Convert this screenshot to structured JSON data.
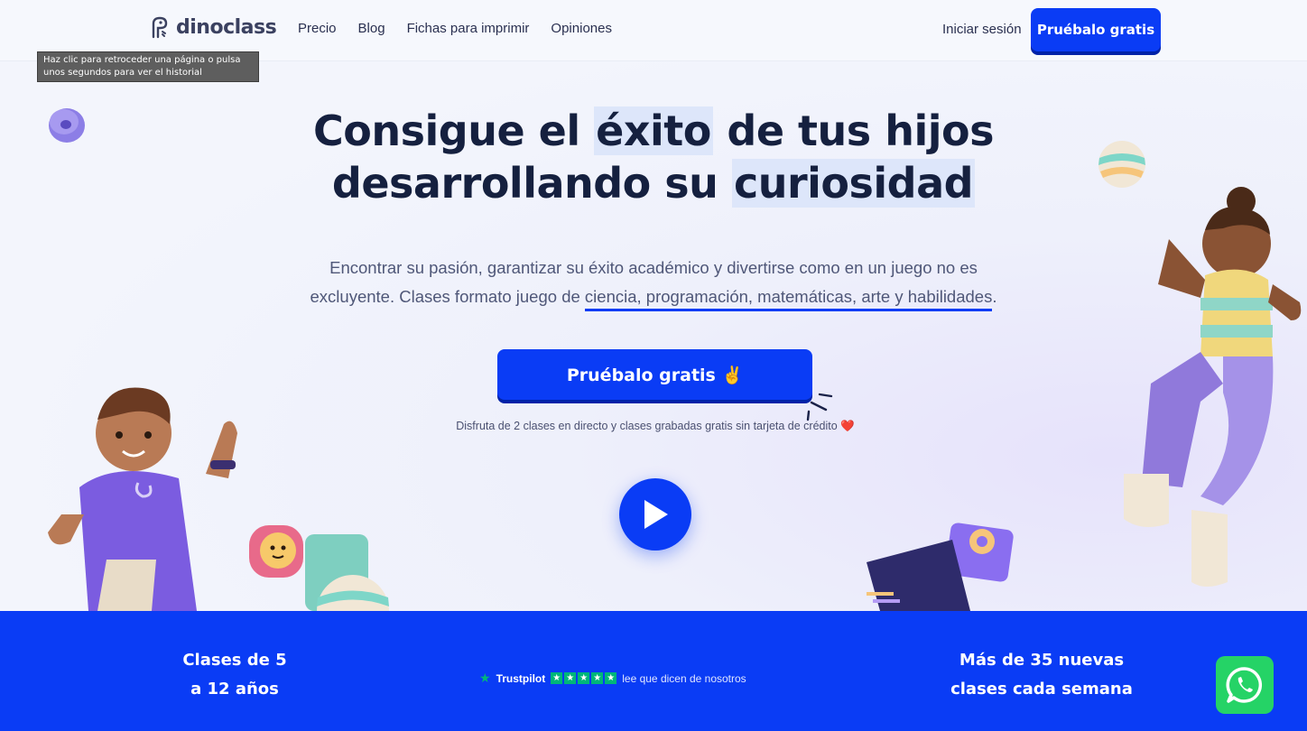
{
  "nav": {
    "logo": "dinoclass",
    "links": [
      "Precio",
      "Blog",
      "Fichas para imprimir",
      "Opiniones"
    ],
    "login": "Iniciar sesión",
    "cta": "Pruébalo gratis"
  },
  "tooltip": "Haz clic para retroceder una página o pulsa unos segundos para ver el historial",
  "hero": {
    "headline_part1": "Consigue el ",
    "headline_hl1": "éxito",
    "headline_part2": " de tus hijos",
    "headline_part3": "desarrollando su ",
    "headline_hl2": "curiosidad",
    "subtitle_part1": "Encontrar su pasión, garantizar su éxito académico y divertirse como en un juego no es excluyente. Clases formato juego de ",
    "subtitle_underlined": "ciencia, programación, matemáticas, arte y habilidades",
    "subtitle_end": ".",
    "cta": "Pruébalo gratis ✌️",
    "note": "Disfruta de 2 clases en directo y clases grabadas gratis sin tarjeta de crédito",
    "note_heart": "❤️"
  },
  "band": {
    "stat_left_line1": "Clases de 5",
    "stat_left_line2": "a 12 años",
    "trustpilot_brand": "Trustpilot",
    "trustpilot_text": "lee que dicen de nosotros",
    "stat_right_line1": "Más de 35 nuevas",
    "stat_right_line2": "clases cada semana"
  },
  "colors": {
    "brand_blue": "#0a3cf5",
    "navy": "#15203f",
    "whatsapp": "#25d366",
    "trustpilot": "#00b67a"
  },
  "icons": [
    "dino-logo-icon",
    "play-icon",
    "trustpilot-star-icon",
    "whatsapp-icon"
  ]
}
